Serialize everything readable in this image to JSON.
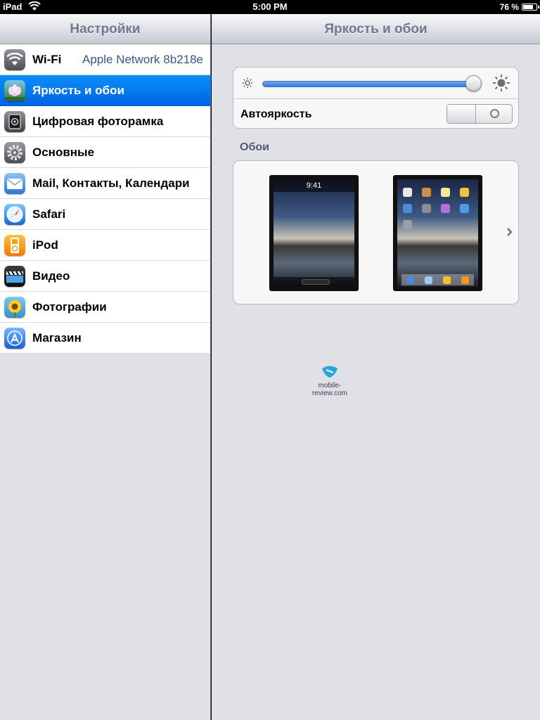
{
  "status_bar": {
    "carrier": "iPad",
    "time": "5:00 PM",
    "battery": "76 %",
    "battery_level": 0.76
  },
  "left_pane": {
    "title": "Настройки",
    "items": [
      {
        "label": "Wi-Fi",
        "detail": "Apple Network 8b218e",
        "icon": "wifi-icon"
      },
      {
        "label": "Яркость и обои",
        "icon": "brightness-wallpaper-icon",
        "selected": true
      },
      {
        "label": "Цифровая фоторамка",
        "icon": "picture-frame-icon"
      },
      {
        "label": "Основные",
        "icon": "gear-icon"
      },
      {
        "label": "Mail, Контакты, Календари",
        "icon": "mail-icon"
      },
      {
        "label": "Safari",
        "icon": "safari-compass-icon"
      },
      {
        "label": "iPod",
        "icon": "ipod-icon"
      },
      {
        "label": "Видео",
        "icon": "video-clapper-icon"
      },
      {
        "label": "Фотографии",
        "icon": "sunflower-icon"
      },
      {
        "label": "Магазин",
        "icon": "app-store-icon"
      }
    ]
  },
  "right_pane": {
    "title": "Яркость и обои",
    "brightness": {
      "level": 0.98,
      "auto_label": "Автояркость",
      "auto_on": false
    },
    "wallpaper": {
      "section_title": "Обои",
      "lock_screen_time": "9:41"
    }
  },
  "watermark": {
    "text": "mobile-review.com"
  },
  "colors": {
    "selection_blue": "#0a72ee",
    "detail_blue": "#385487",
    "pane_background": "#dfe1e6"
  }
}
